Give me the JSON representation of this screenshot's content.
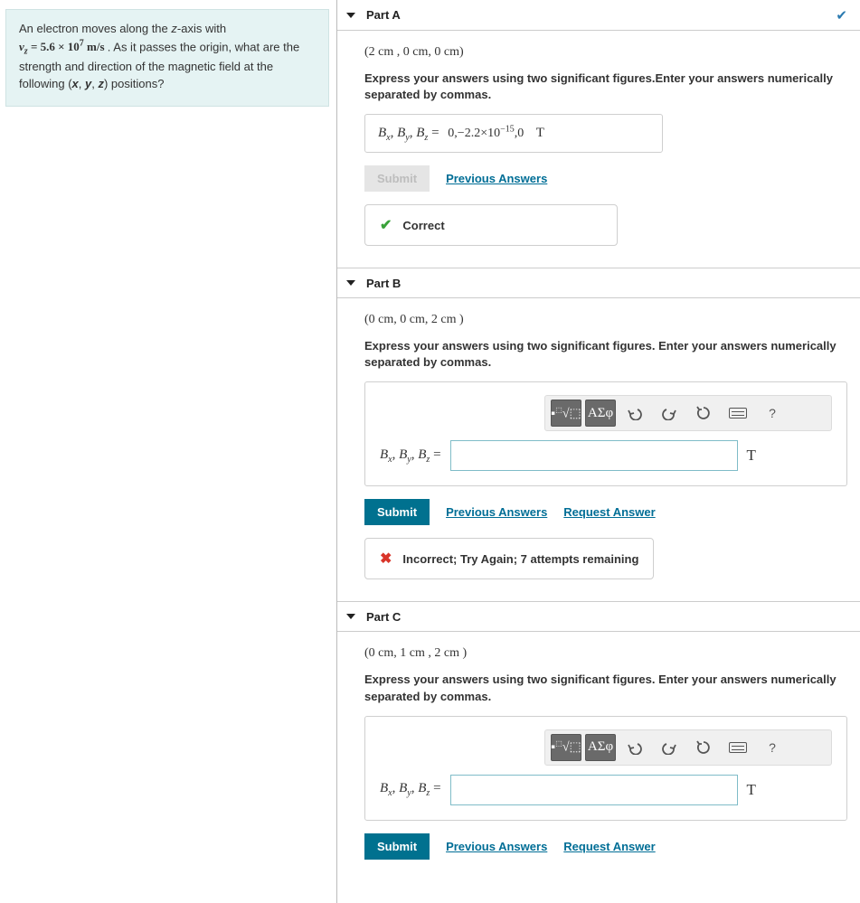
{
  "problem": {
    "intro_pre": "An electron moves along the ",
    "axis_var": "z",
    "intro_mid": "-axis with",
    "velocity_var": "v",
    "velocity_sub": "z",
    "velocity_eq": " = 5.6 × 10",
    "velocity_exp": "7",
    "velocity_units": " m/s",
    "intro_post": ". As it passes the origin, what are the strength and direction of the magnetic field at the following (",
    "coord_x": "x",
    "coord_y": "y",
    "coord_z": "z",
    "intro_end": ") positions?"
  },
  "labels": {
    "field_lhs": "B",
    "sub_x": "x",
    "sub_y": "y",
    "sub_z": "z",
    "equals": " = ",
    "unit": "T",
    "submit": "Submit",
    "previous_answers": "Previous Answers",
    "request_answer": "Request Answer",
    "correct": "Correct",
    "toolbar_greek": "ΑΣφ",
    "toolbar_help": "?"
  },
  "parts": [
    {
      "name": "Part A",
      "completed": true,
      "coords": "(2 cm , 0 cm, 0 cm)",
      "instructions": "Express your answers using two significant figures.Enter your answers numerically separated by commas.",
      "answer_value": "0,−2.2×10",
      "answer_exp": "−15",
      "answer_suffix": ",0",
      "feedback": {
        "status": "correct",
        "text": "Correct"
      }
    },
    {
      "name": "Part B",
      "completed": false,
      "coords": "(0 cm, 0 cm, 2 cm )",
      "instructions": "Express your answers using two significant figures. Enter your answers numerically separated by commas.",
      "feedback": {
        "status": "incorrect",
        "text": "Incorrect; Try Again; 7 attempts remaining"
      }
    },
    {
      "name": "Part C",
      "completed": false,
      "coords": "(0 cm, 1 cm , 2 cm )",
      "instructions": "Express your answers using two significant figures. Enter your answers numerically separated by commas."
    }
  ]
}
